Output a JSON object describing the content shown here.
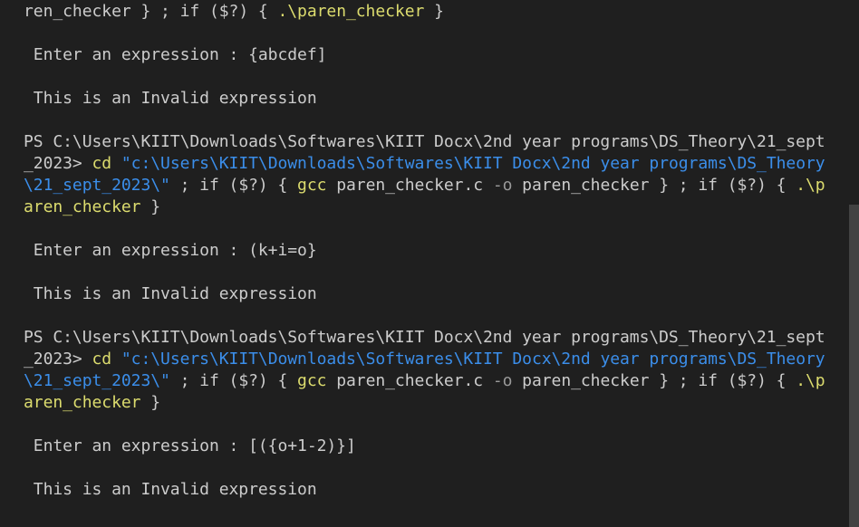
{
  "terminal": {
    "lines": [
      {
        "segments": [
          {
            "text": "ren_checker } ; ",
            "cls": "plain"
          },
          {
            "text": "if ($?) { ",
            "cls": "plain"
          },
          {
            "text": ".\\paren_checker",
            "cls": "cmd"
          },
          {
            "text": " }",
            "cls": "plain"
          }
        ]
      },
      {
        "segments": [
          {
            "text": " Enter an expression : {abcdef]",
            "cls": "plain"
          }
        ]
      },
      {
        "segments": [
          {
            "text": " This is an Invalid expression",
            "cls": "plain"
          }
        ]
      },
      {
        "segments": [
          {
            "text": "PS C:\\Users\\KIIT\\Downloads\\Softwares\\KIIT Docx\\2nd year programs\\DS_Theory\\21_sept",
            "cls": "plain"
          }
        ]
      },
      {
        "segments": [
          {
            "text": "_2023> ",
            "cls": "plain"
          },
          {
            "text": "cd ",
            "cls": "cmd"
          },
          {
            "text": "\"c:\\Users\\KIIT\\Downloads\\Softwares\\KIIT Docx\\2nd year programs\\DS_Theory",
            "cls": "str"
          }
        ]
      },
      {
        "segments": [
          {
            "text": "\\21_sept_2023\\\"",
            "cls": "str"
          },
          {
            "text": " ; if ($?) { ",
            "cls": "plain"
          },
          {
            "text": "gcc",
            "cls": "cmd"
          },
          {
            "text": " paren_checker.c ",
            "cls": "plain"
          },
          {
            "text": "-o",
            "cls": "flag"
          },
          {
            "text": " paren_checker } ; if ($?) { ",
            "cls": "plain"
          },
          {
            "text": ".\\p",
            "cls": "cmd"
          }
        ]
      },
      {
        "segments": [
          {
            "text": "aren_checker",
            "cls": "cmd"
          },
          {
            "text": " }",
            "cls": "plain"
          }
        ]
      },
      {
        "segments": [
          {
            "text": " Enter an expression : (k+i=o}",
            "cls": "plain"
          }
        ]
      },
      {
        "segments": [
          {
            "text": " This is an Invalid expression",
            "cls": "plain"
          }
        ]
      },
      {
        "segments": [
          {
            "text": "PS C:\\Users\\KIIT\\Downloads\\Softwares\\KIIT Docx\\2nd year programs\\DS_Theory\\21_sept",
            "cls": "plain"
          }
        ]
      },
      {
        "segments": [
          {
            "text": "_2023> ",
            "cls": "plain"
          },
          {
            "text": "cd ",
            "cls": "cmd"
          },
          {
            "text": "\"c:\\Users\\KIIT\\Downloads\\Softwares\\KIIT Docx\\2nd year programs\\DS_Theory",
            "cls": "str"
          }
        ]
      },
      {
        "segments": [
          {
            "text": "\\21_sept_2023\\\"",
            "cls": "str"
          },
          {
            "text": " ; if ($?) { ",
            "cls": "plain"
          },
          {
            "text": "gcc",
            "cls": "cmd"
          },
          {
            "text": " paren_checker.c ",
            "cls": "plain"
          },
          {
            "text": "-o",
            "cls": "flag"
          },
          {
            "text": " paren_checker } ; if ($?) { ",
            "cls": "plain"
          },
          {
            "text": ".\\p",
            "cls": "cmd"
          }
        ]
      },
      {
        "segments": [
          {
            "text": "aren_checker",
            "cls": "cmd"
          },
          {
            "text": " }",
            "cls": "plain"
          }
        ]
      },
      {
        "segments": [
          {
            "text": " Enter an expression : [({o+1-2)}]",
            "cls": "plain"
          }
        ]
      },
      {
        "segments": [
          {
            "text": " This is an Invalid expression",
            "cls": "plain"
          }
        ]
      }
    ]
  },
  "colors": {
    "background": "#1f1f1f",
    "text": "#cccccc",
    "command": "#dcdc6e",
    "string": "#3b8eea",
    "scrollbar_thumb": "#424242"
  }
}
